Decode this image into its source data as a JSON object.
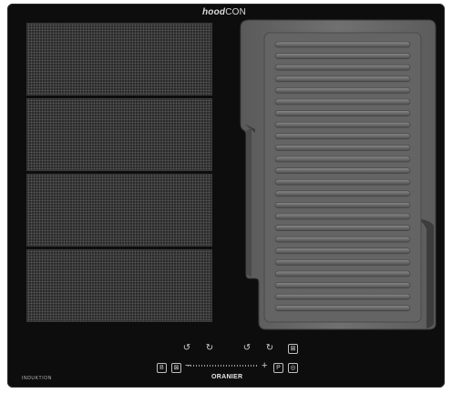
{
  "brand_top": {
    "bold": "hood",
    "regular": "CON"
  },
  "brand_bottom": "ORANIER",
  "induktion_label": "INDUKTION",
  "controls": {
    "row1": [
      "timer-left-1",
      "timer-left-2",
      "timer-right-1",
      "timer-right-2",
      "lock"
    ],
    "lock_symbol": "⊠",
    "minus": "−",
    "plus": "+",
    "boost_label": "P",
    "keep_warm_symbol": "◎",
    "bridge_symbol": "B",
    "flex_symbol": "⊠"
  },
  "colors": {
    "glass": "#0d0d0d",
    "zone": "#262626",
    "grill": "#6b6b6b",
    "text": "#cfcfcf"
  }
}
